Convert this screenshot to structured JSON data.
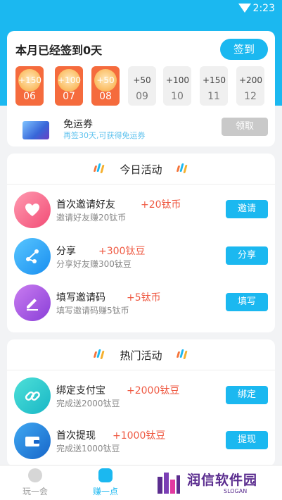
{
  "status_bar": {
    "time": "2:23"
  },
  "checkin": {
    "title": "本月已经签到0天",
    "button": "签到",
    "days": [
      {
        "reward": "+150",
        "date": "06",
        "done": true
      },
      {
        "reward": "+100",
        "date": "07",
        "done": true
      },
      {
        "reward": "+50",
        "date": "08",
        "done": true
      },
      {
        "reward": "+50",
        "date": "09",
        "done": false
      },
      {
        "reward": "+100",
        "date": "10",
        "done": false
      },
      {
        "reward": "+150",
        "date": "11",
        "done": false
      },
      {
        "reward": "+200",
        "date": "12",
        "done": false
      }
    ],
    "ticket": {
      "name": "免运券",
      "desc": "再签30天,可获得免运券",
      "button": "领取"
    }
  },
  "today": {
    "title": "今日活动",
    "tasks": [
      {
        "name": "首次邀请好友",
        "reward": "+20钛币",
        "desc": "邀请好友赚20钛币",
        "button": "邀请",
        "icon": "heart-icon"
      },
      {
        "name": "分享",
        "reward": "+300钛豆",
        "desc": "分享好友赚300钛豆",
        "button": "分享",
        "icon": "share-icon"
      },
      {
        "name": "填写邀请码",
        "reward": "+5钛币",
        "desc": "填写邀请码赚5钛币",
        "button": "填写",
        "icon": "pen-icon"
      }
    ]
  },
  "hot": {
    "title": "热门活动",
    "tasks": [
      {
        "name": "绑定支付宝",
        "reward": "+2000钛豆",
        "desc": "完成送2000钛豆",
        "button": "绑定",
        "icon": "link-icon"
      },
      {
        "name": "首次提现",
        "reward": "+1000钛豆",
        "desc": "完成送1000钛豆",
        "button": "提现",
        "icon": "wallet-icon"
      }
    ]
  },
  "nav": {
    "play": "玩一会",
    "earn": "赚一点"
  },
  "watermark": {
    "text": "润信软件园",
    "sub": "SLOGAN"
  },
  "colors": {
    "accent": "#1bb8f0",
    "reward": "#ef5a43",
    "checked": "#f56b3d"
  }
}
